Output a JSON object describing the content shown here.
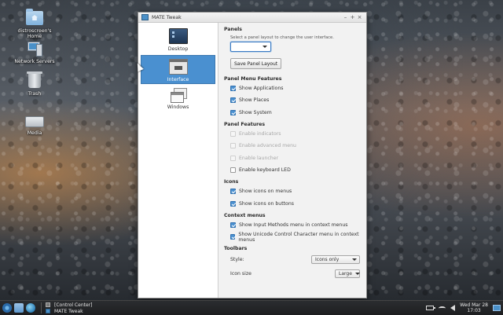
{
  "desktop": {
    "icons": [
      {
        "label": "distroscreen's Home",
        "icon": "home-folder-icon"
      },
      {
        "label": "Network Servers",
        "icon": "network-servers-icon"
      },
      {
        "label": "Trash",
        "icon": "trash-icon"
      },
      {
        "label": "Media",
        "icon": "drive-icon"
      }
    ]
  },
  "window": {
    "title": "MATE Tweak",
    "controls": {
      "minimize": "–",
      "maximize": "+",
      "close": "×"
    },
    "sidebar": {
      "items": [
        {
          "label": "Desktop",
          "icon": "desktop-icon",
          "active": false
        },
        {
          "label": "Interface",
          "icon": "interface-icon",
          "active": true
        },
        {
          "label": "Windows",
          "icon": "windows-icon",
          "active": false
        }
      ]
    },
    "content": {
      "panels": {
        "title": "Panels",
        "hint": "Select a panel layout to change the user interface.",
        "layout_value": "",
        "save_button": "Save Panel Layout"
      },
      "panel_menu_features": {
        "title": "Panel Menu Features",
        "items": [
          {
            "label": "Show Applications",
            "checked": true,
            "enabled": true
          },
          {
            "label": "Show Places",
            "checked": true,
            "enabled": true
          },
          {
            "label": "Show System",
            "checked": true,
            "enabled": true
          }
        ]
      },
      "panel_features": {
        "title": "Panel Features",
        "items": [
          {
            "label": "Enable indicators",
            "checked": false,
            "enabled": false
          },
          {
            "label": "Enable advanced menu",
            "checked": false,
            "enabled": false
          },
          {
            "label": "Enable launcher",
            "checked": false,
            "enabled": false
          },
          {
            "label": "Enable keyboard LED",
            "checked": false,
            "enabled": true
          }
        ]
      },
      "icons": {
        "title": "Icons",
        "items": [
          {
            "label": "Show icons on menus",
            "checked": true,
            "enabled": true
          },
          {
            "label": "Show icons on buttons",
            "checked": true,
            "enabled": true
          }
        ]
      },
      "context_menus": {
        "title": "Context menus",
        "items": [
          {
            "label": "Show Input Methods menu in context menus",
            "checked": true,
            "enabled": true
          },
          {
            "label": "Show Unicode Control Character menu in context menus",
            "checked": true,
            "enabled": true
          }
        ]
      },
      "toolbars": {
        "title": "Toolbars",
        "style_label": "Style:",
        "style_value": "Icons only",
        "icon_size_label": "Icon size",
        "icon_size_value": "Large"
      }
    }
  },
  "taskbar": {
    "windows": [
      {
        "label": "[Control Center]",
        "icon": "control-center-icon"
      },
      {
        "label": "MATE Tweak",
        "icon": "mate-tweak-icon"
      }
    ],
    "clock": {
      "date": "Wed Mar 28",
      "time": "17:03"
    }
  },
  "colors": {
    "accent": "#4a90d0",
    "taskbar": "#232427",
    "window_bg": "#f2f2f2"
  }
}
